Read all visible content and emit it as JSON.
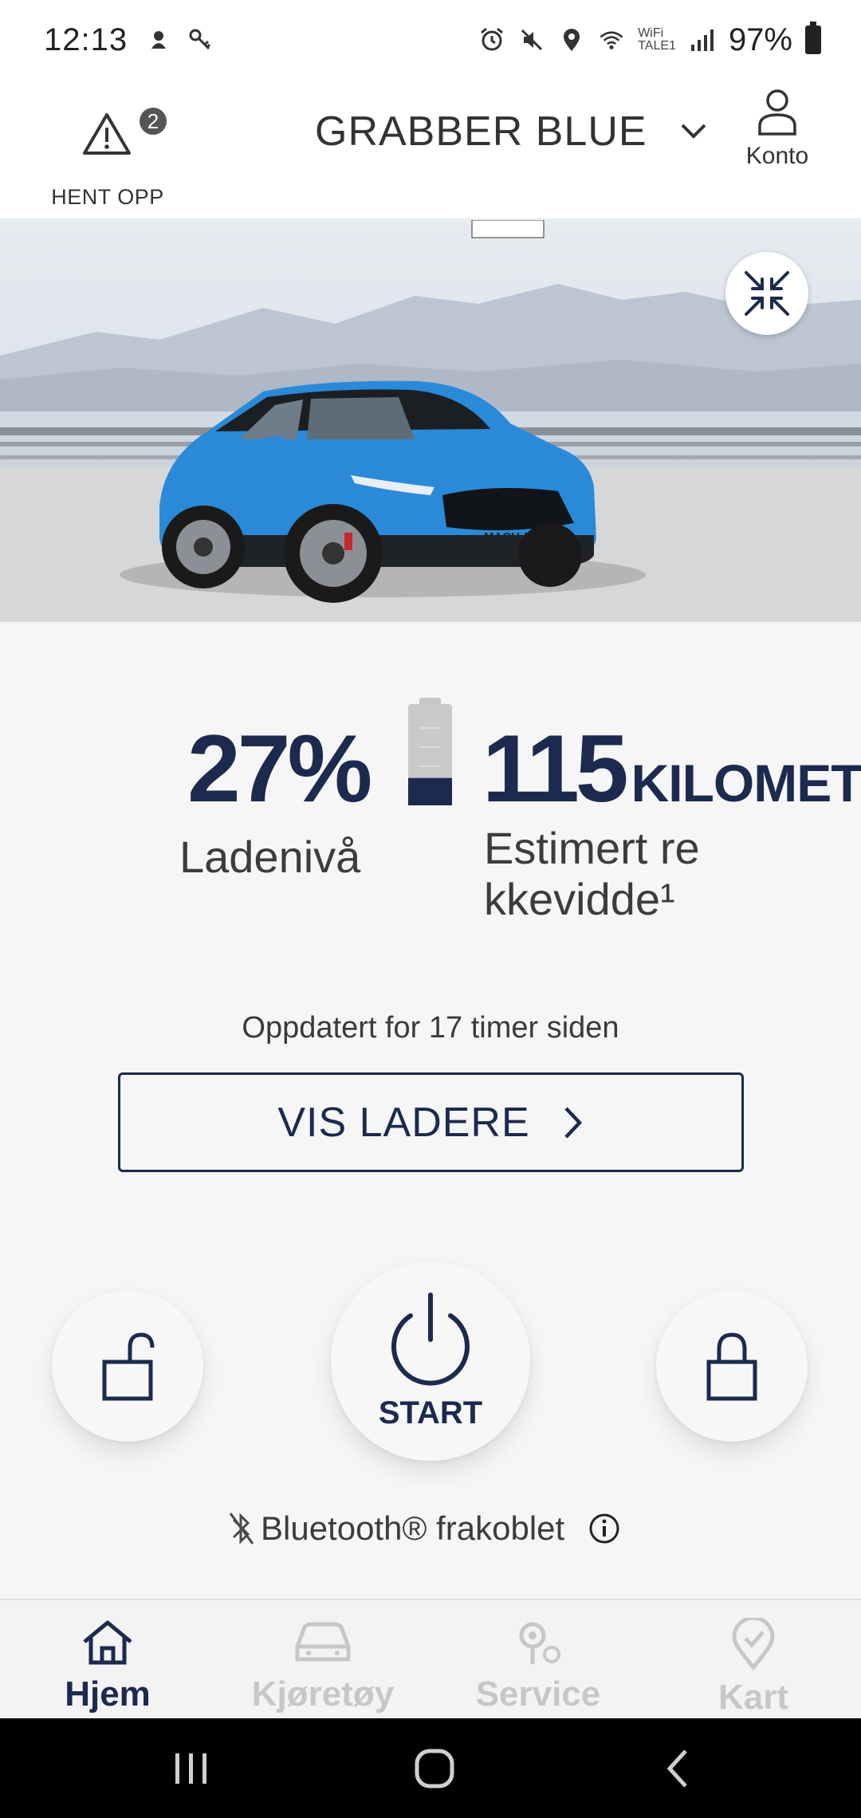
{
  "status_bar": {
    "time": "12:13",
    "wifi_label_top": "WiFi",
    "wifi_label_bottom": "TALE1",
    "battery": "97%"
  },
  "header": {
    "recall_label": "HENT OPP",
    "recall_count": "2",
    "vehicle_name": "GRABBER BLUE",
    "account_label": "Konto"
  },
  "hero": {
    "plate_text": "MACH-E",
    "car_color": "#2a8ad8"
  },
  "stats": {
    "charge_percent": "27%",
    "charge_label": "Ladenivå",
    "charge_level_fraction": 0.27,
    "range_value": "115",
    "range_unit": "KILOMETE",
    "range_label": "Estimert rekkevidde¹",
    "updated": "Oppdatert for 17 timer siden"
  },
  "chargers_button": {
    "label": "VIS LADERE"
  },
  "controls": {
    "start_label": "START"
  },
  "bluetooth": {
    "status": "Bluetooth® frakoblet"
  },
  "bottom_nav": {
    "items": [
      {
        "label": "Hjem",
        "icon": "home-icon",
        "active": true
      },
      {
        "label": "Kjøretøy",
        "icon": "car-icon",
        "active": false
      },
      {
        "label": "Service",
        "icon": "service-icon",
        "active": false
      },
      {
        "label": "Kart",
        "icon": "map-pin-icon",
        "active": false
      }
    ]
  },
  "colors": {
    "navy": "#1b2a4e",
    "inactive": "#c7c7cb"
  }
}
